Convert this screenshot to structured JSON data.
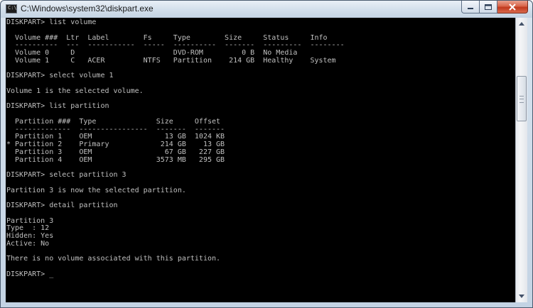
{
  "window": {
    "title": "C:\\Windows\\system32\\diskpart.exe",
    "icon_label": "C:\\",
    "buttons": [
      "minimize",
      "maximize",
      "close"
    ]
  },
  "console": {
    "lines": [
      "DISKPART> list volume",
      "",
      "  Volume ###  Ltr  Label        Fs     Type        Size     Status     Info",
      "  ----------  ---  -----------  -----  ----------  -------  ---------  --------",
      "  Volume 0     D                       DVD-ROM         0 B  No Media",
      "  Volume 1     C   ACER         NTFS   Partition    214 GB  Healthy    System",
      "",
      "DISKPART> select volume 1",
      "",
      "Volume 1 is the selected volume.",
      "",
      "DISKPART> list partition",
      "",
      "  Partition ###  Type              Size     Offset",
      "  -------------  ----------------  -------  -------",
      "  Partition 1    OEM                 13 GB  1024 KB",
      "* Partition 2    Primary            214 GB    13 GB",
      "  Partition 3    OEM                 67 GB   227 GB",
      "  Partition 4    OEM               3573 MB   295 GB",
      "",
      "DISKPART> select partition 3",
      "",
      "Partition 3 is now the selected partition.",
      "",
      "DISKPART> detail partition",
      "",
      "Partition 3",
      "Type  : 12",
      "Hidden: Yes",
      "Active: No",
      "",
      "There is no volume associated with this partition.",
      "",
      "DISKPART> "
    ],
    "cursor": "_"
  },
  "colors": {
    "console_bg": "#000000",
    "console_fg": "#c0c0c0",
    "close_button": "#c9452a"
  }
}
